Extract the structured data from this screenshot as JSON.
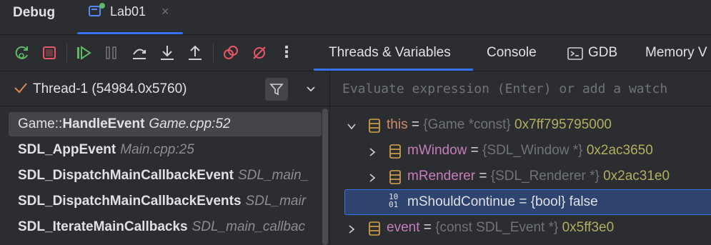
{
  "tabbar": {
    "title": "Debug",
    "session_tab": "Lab01",
    "close_glyph": "×"
  },
  "toolbar": {
    "tabs": [
      "Threads & Variables",
      "Console",
      "GDB",
      "Memory V"
    ],
    "more_glyph": "⋮"
  },
  "threads": {
    "selected": "Thread-1 (54984.0x5760)",
    "frames": [
      {
        "ns": "Game::",
        "fn": "HandleEvent",
        "loc": "Game.cpp:52"
      },
      {
        "ns": "",
        "fn": "SDL_AppEvent",
        "loc": "Main.cpp:25"
      },
      {
        "ns": "",
        "fn": "SDL_DispatchMainCallbackEvent",
        "loc": "SDL_main_"
      },
      {
        "ns": "",
        "fn": "SDL_DispatchMainCallbackEvents",
        "loc": "SDL_mair"
      },
      {
        "ns": "",
        "fn": "SDL_IterateMainCallbacks",
        "loc": "SDL_main_callbac"
      }
    ]
  },
  "variables": {
    "placeholder": "Evaluate expression (Enter) or add a watch",
    "this_var": {
      "name": "this",
      "eq": " = ",
      "type": "{Game *const}",
      "value": "0x7ff795795000"
    },
    "window": {
      "name": "mWindow",
      "eq": " = ",
      "type": "{SDL_Window *}",
      "value": "0x2ac3650"
    },
    "renderer": {
      "name": "mRenderer",
      "eq": " = ",
      "type": "{SDL_Renderer *}",
      "value": "0x2ac31e0"
    },
    "should_continue": {
      "text": "mShouldContinue = {bool} false",
      "icon_top": "10",
      "icon_bottom": "01"
    },
    "event": {
      "name": "event",
      "eq": " = ",
      "type": "{const SDL_Event *}",
      "value": "0x5ff3e0"
    }
  },
  "colors": {
    "accent": "#3574f0",
    "background": "#2b2d30",
    "selection": "#2e436e"
  }
}
